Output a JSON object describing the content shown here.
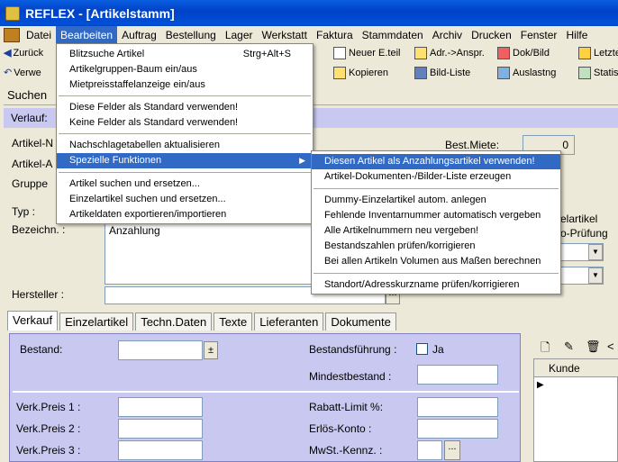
{
  "window": {
    "title": "REFLEX - [Artikelstamm]"
  },
  "menubar": {
    "items": [
      "Datei",
      "Bearbeiten",
      "Auftrag",
      "Bestellung",
      "Lager",
      "Werkstatt",
      "Faktura",
      "Stammdaten",
      "Archiv",
      "Drucken",
      "Fenster",
      "Hilfe"
    ],
    "active": "Bearbeiten"
  },
  "toolbar": {
    "row1": {
      "back": "Zurück",
      "new_part": "Neuer E.teil",
      "addr": "Adr.->Anspr.",
      "doc": "Dok/Bild",
      "last": "Letzte"
    },
    "row2": {
      "manage": "Verwe",
      "copy": "Kopieren",
      "image_list": "Bild-Liste",
      "utilization": "Auslastng",
      "stats": "Statis"
    }
  },
  "form": {
    "search_label": "Suchen",
    "history_label": "Verlauf:",
    "article_n_label": "Artikel-N",
    "article_a_label": "Artikel-A",
    "group_label": "Gruppe",
    "type_label": "Typ :",
    "description_label": "Bezeichn. :",
    "description_value": "Anzahlung",
    "manufacturer_label": "Hersteller :",
    "manufacturer_button": "...",
    "rent_label": "Best.Miete:",
    "rent_value": "0",
    "side_text_1": "elartikel",
    "side_text_2": "o-Prüfung"
  },
  "tabs": [
    "Verkauf",
    "Einzelartikel",
    "Techn.Daten",
    "Texte",
    "Lieferanten",
    "Dokumente"
  ],
  "sales": {
    "stock_label": "Bestand:",
    "stock_button": "±",
    "stock_mgmt_label": "Bestandsführung :",
    "stock_mgmt_value": "Ja",
    "min_stock_label": "Mindestbestand :",
    "price1_label": "Verk.Preis 1 :",
    "price2_label": "Verk.Preis 2 :",
    "price3_label": "Verk.Preis 3 :",
    "discount_label": "Rabatt-Limit %:",
    "revenue_label": "Erlös-Konto :",
    "vat_label": "MwSt.-Kennz. :",
    "vat_button": "...",
    "customer_col": "Kunde"
  },
  "menu_bearbeiten": {
    "items": [
      {
        "label": "Blitzsuche Artikel",
        "shortcut": "Strg+Alt+S"
      },
      {
        "label": "Artikelgruppen-Baum ein/aus"
      },
      {
        "label": "Mietpreisstaffelanzeige ein/aus"
      },
      {
        "label": "Diese Felder als Standard verwenden!"
      },
      {
        "label": "Keine Felder als Standard verwenden!"
      },
      {
        "label": "Nachschlagetabellen aktualisieren"
      },
      {
        "label": "Spezielle Funktionen",
        "arrow": "▶"
      },
      {
        "label": "Artikel suchen und ersetzen..."
      },
      {
        "label": "Einzelartikel suchen und ersetzen..."
      },
      {
        "label": "Artikeldaten exportieren/importieren"
      }
    ]
  },
  "menu_spezial": {
    "items": [
      {
        "label": "Diesen Artikel als Anzahlungsartikel verwenden!"
      },
      {
        "label": "Artikel-Dokumenten-/Bilder-Liste erzeugen"
      },
      {
        "label": "Dummy-Einzelartikel autom. anlegen"
      },
      {
        "label": "Fehlende Inventarnummer automatisch vergeben"
      },
      {
        "label": "Alle Artikelnummern neu vergeben!"
      },
      {
        "label": "Bestandszahlen prüfen/korrigieren"
      },
      {
        "label": "Bei allen Artikeln Volumen aus Maßen berechnen"
      },
      {
        "label": "Standort/Adresskurzname prüfen/korrigieren"
      }
    ]
  }
}
